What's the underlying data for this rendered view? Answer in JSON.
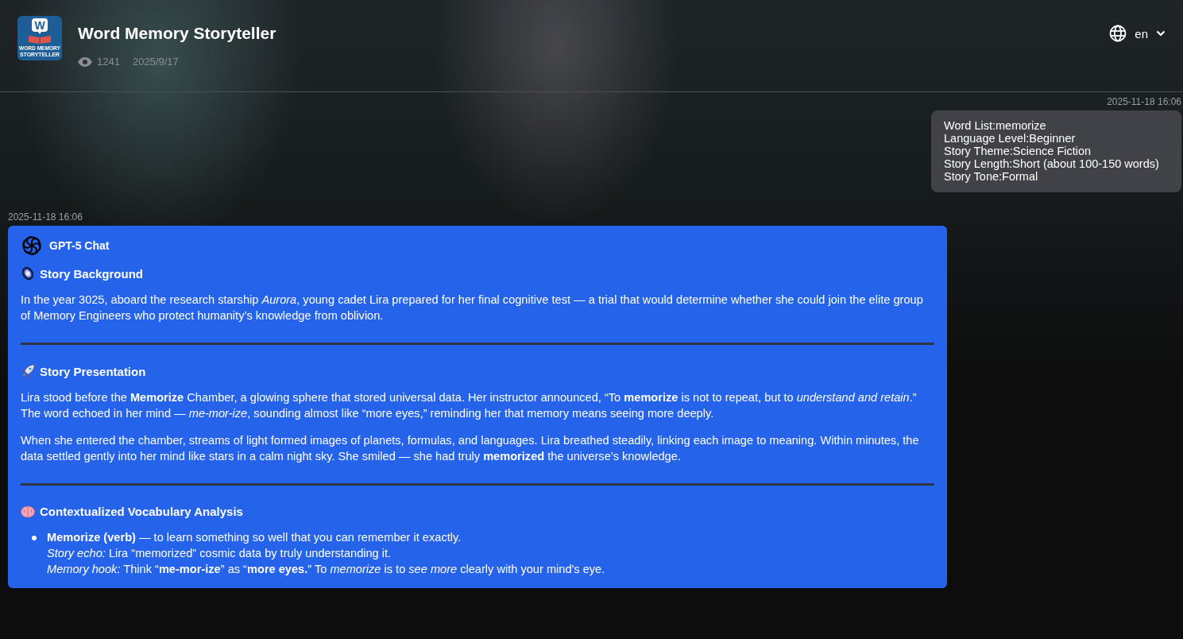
{
  "app": {
    "logo": {
      "letter": "W",
      "caption_1": "WORD MEMORY",
      "caption_2": "STORYTELLER"
    },
    "title": "Word Memory Storyteller",
    "views": "1241",
    "date": "2025/9/17"
  },
  "language": {
    "value": "en"
  },
  "user_message": {
    "time": "2025-11-18 16:06",
    "lines": [
      "Word List:memorize",
      "Language Level:Beginner",
      "Story Theme:Science Fiction",
      "Story Length:Short (about 100-150 words)",
      "Story Tone:Formal"
    ]
  },
  "bot_message": {
    "time": "2025-11-18 16:06",
    "model": "GPT-5 Chat",
    "blocks": [
      {
        "kind": "heading",
        "text": "Story Background"
      },
      {
        "kind": "paragraph",
        "text": "In the year 3025, aboard the research starship *Aurora*, young cadet Lira prepared for her final cognitive test — a trial that would determine whether she could join the elite group of Memory Engineers who protect humanity’s knowledge from oblivion."
      },
      {
        "kind": "divider"
      },
      {
        "kind": "heading",
        "text": "Story Presentation"
      },
      {
        "kind": "paragraph",
        "text": "Lira stood before the **Memorize** Chamber, a glowing sphere that stored universal data. Her instructor announced, “To **memorize** is not to repeat, but to *understand and retain*.” The word echoed in her mind — *me-mor-ize*, sounding almost like “more eyes,” reminding her that memory means seeing more deeply."
      },
      {
        "kind": "paragraph",
        "text": "When she entered the chamber, streams of light formed images of planets, formulas, and languages. Lira breathed steadily, linking each image to meaning. Within minutes, the data settled gently into her mind like stars in a calm night sky. She smiled — she had truly **memorized** the universe’s knowledge."
      },
      {
        "kind": "divider"
      },
      {
        "kind": "heading",
        "text": "Contextualized Vocabulary Analysis"
      },
      {
        "kind": "list",
        "items": [
          {
            "lines": [
              "**Memorize (verb)** — to learn something so well that you can remember it exactly.",
              "*Story echo:* Lira “memorized” cosmic data by truly understanding it.",
              "*Memory hook:* Think “**me-mor-ize**” as “**more eyes.**” To *memorize* is to *see more* clearly with your mind's eye."
            ]
          }
        ]
      }
    ]
  }
}
